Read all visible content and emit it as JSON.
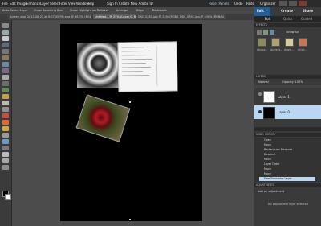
{
  "menubar": {
    "items": [
      "File",
      "Edit",
      "Image",
      "Enhance",
      "Layer",
      "Select",
      "Filter",
      "View",
      "Window",
      "Help"
    ],
    "sign_in": "Sign In",
    "create_id": "Create New Adobe ID",
    "reset_panels": "Reset Panels",
    "undo": "Undo",
    "redo": "Redo",
    "organizer": "Organizer"
  },
  "mode_tabs": {
    "edit": "Edit",
    "create": "Create",
    "share": "Share",
    "full": "Full",
    "quick": "Quick",
    "guided": "Guided"
  },
  "options": {
    "auto_select": "Auto Select Layer",
    "bounding_box": "Show Bounding Box",
    "highlight": "Show Highlight on Rollover",
    "arrange": "Arrange",
    "align": "Align",
    "distribute": "Distribute"
  },
  "doc_tabs": [
    "Screen shot 2011-08-21 at 8.07.45 PM.png @ 66.7% (RGB/8)",
    "Untitled-1 @ 25% (Layer 0, RGB/8)",
    "DSC_0351.jpg @ 25% (RGB/8)",
    "DSC_0351.jpg @ 100% (RGB/8)"
  ],
  "effects": {
    "title": "EFFECTS",
    "show_all": "Show All",
    "thumbs": [
      "Abstra...",
      "Ancient...",
      "Angle...",
      "Artist..."
    ]
  },
  "layers": {
    "title": "LAYERS",
    "blend": "Normal",
    "opacity": "Opacity: 100%",
    "items": [
      {
        "name": "Layer 1"
      },
      {
        "name": "Layer 0"
      }
    ]
  },
  "undo_history": {
    "title": "UNDO HISTORY",
    "items": [
      "Open",
      "Move",
      "Rectangular Marquee",
      "Deselect",
      "Move",
      "Layer Order",
      "Move",
      "Move",
      "Free Transform Layer"
    ]
  },
  "adjustments": {
    "title": "ADJUSTMENTS",
    "add": "Add an adjustment",
    "none": "No adjustment layer selected"
  },
  "colors": {
    "accent": "#2f8fd6",
    "selected": "#b9d6f2"
  }
}
